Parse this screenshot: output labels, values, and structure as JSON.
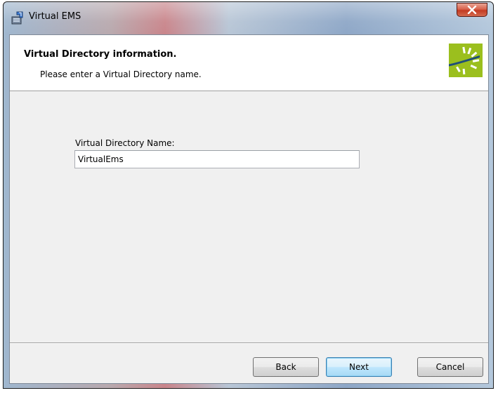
{
  "window": {
    "title": "Virtual EMS"
  },
  "banner": {
    "title": "Virtual Directory information.",
    "subtitle": "Please enter a Virtual Directory name."
  },
  "form": {
    "directory_name_label": "Virtual Directory Name:",
    "directory_name_value": "VirtualEms"
  },
  "buttons": {
    "back_label": "Back",
    "next_label": "Next",
    "cancel_label": "Cancel"
  },
  "icons": {
    "title_icon": "installer-package-icon",
    "logo": "ems-logo-icon",
    "close": "close-icon"
  },
  "colors": {
    "logo_green": "#9bbf1e",
    "logo_blue": "#1f4e79",
    "close_red": "#c9432b",
    "dialog_bg": "#f0f0f0"
  }
}
